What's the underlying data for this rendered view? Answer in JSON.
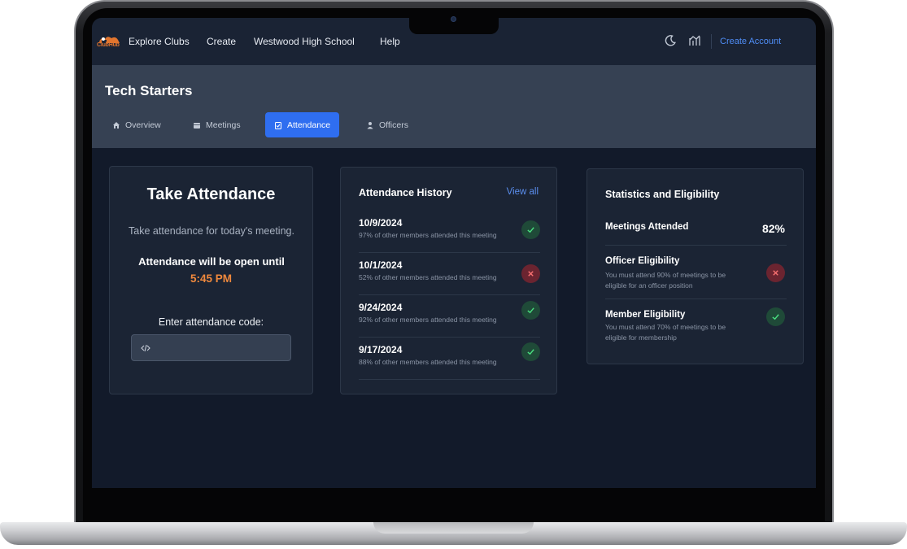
{
  "nav": {
    "logo_text": "ClubHub",
    "links": [
      "Explore Clubs",
      "Create",
      "Westwood High School",
      "Help"
    ],
    "create_account": "Create Account",
    "icons": [
      "moon-icon",
      "chart-icon"
    ]
  },
  "club": {
    "title": "Tech Starters",
    "tabs": [
      {
        "label": "Overview",
        "icon": "home-icon",
        "active": false
      },
      {
        "label": "Meetings",
        "icon": "calendar-icon",
        "active": false
      },
      {
        "label": "Attendance",
        "icon": "clipboard-icon",
        "active": true
      },
      {
        "label": "Officers",
        "icon": "person-icon",
        "active": false
      }
    ]
  },
  "take_attendance": {
    "title": "Take Attendance",
    "description": "Take attendance for today's meeting.",
    "open_until_label": "Attendance will be open until",
    "open_until_time": "5:45 PM",
    "code_label": "Enter attendance code:",
    "code_placeholder": ""
  },
  "history": {
    "title": "Attendance History",
    "view_all": "View all",
    "rows": [
      {
        "date": "10/9/2024",
        "note": "97% of other members attended this meeting",
        "status": "attended"
      },
      {
        "date": "10/1/2024",
        "note": "52% of other members attended this meeting",
        "status": "missed"
      },
      {
        "date": "9/24/2024",
        "note": "92% of other members attended this meeting",
        "status": "attended"
      },
      {
        "date": "9/17/2024",
        "note": "88% of other members attended this meeting",
        "status": "attended"
      }
    ]
  },
  "stats": {
    "title": "Statistics and Eligibility",
    "meetings_attended_label": "Meetings Attended",
    "meetings_attended_value": "82%",
    "officer": {
      "label": "Officer Eligibility",
      "note": "You must attend 90% of meetings to be eligible for an officer position",
      "eligible": false
    },
    "member": {
      "label": "Member Eligibility",
      "note": "You must attend 70% of meetings to be eligible for membership",
      "eligible": true
    }
  },
  "colors": {
    "accent": "#2f6ef0",
    "time_highlight": "#f0893d",
    "success": "#1f4a38",
    "danger": "#6b2430"
  }
}
